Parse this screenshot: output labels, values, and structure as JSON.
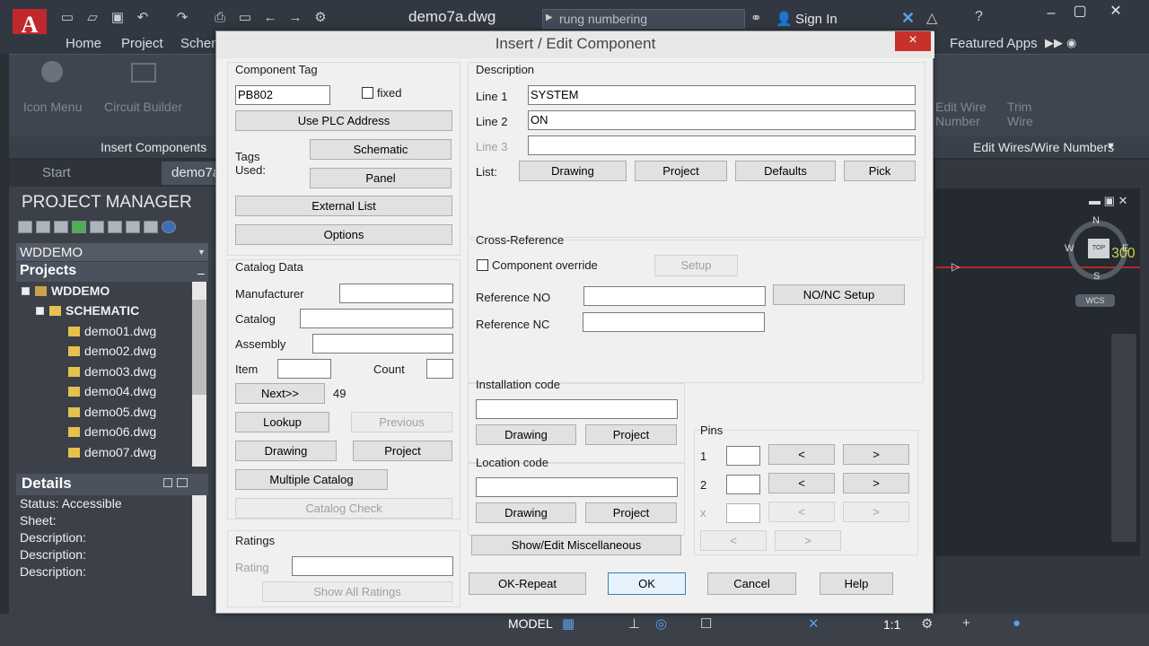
{
  "app": {
    "logo": "A",
    "doc_title": "demo7a.dwg",
    "search_placeholder": "rung numbering",
    "sign_in": "Sign In",
    "ribbon_tabs": [
      "Home",
      "Project",
      "Schem"
    ],
    "featured_apps": "Featured Apps",
    "ribbon_items": [
      "Icon Menu",
      "Circuit Builder",
      "Edit Wire Number",
      "Trim Wire"
    ],
    "ribbon_groups": [
      "Insert Components",
      "Edit Wires/Wire Numbers"
    ],
    "doc_tabs": [
      "Start",
      "demo7a"
    ]
  },
  "project_manager": {
    "title": "PROJECT MANAGER",
    "project_select": "WDDEMO",
    "projects_header": "Projects",
    "tree": {
      "root": "WDDEMO",
      "folder": "SCHEMATIC",
      "files": [
        "demo01.dwg",
        "demo02.dwg",
        "demo03.dwg",
        "demo04.dwg",
        "demo05.dwg",
        "demo06.dwg",
        "demo07.dwg"
      ]
    },
    "details_header": "Details",
    "details": [
      "Status: Accessible",
      "Sheet:",
      "Description:",
      "Description:",
      "Description:"
    ]
  },
  "canvas": {
    "compass": {
      "n": "N",
      "s": "S",
      "e": "E",
      "w": "W",
      "top": "TOP"
    },
    "wcs": "WCS",
    "value": "300"
  },
  "status": {
    "model": "MODEL",
    "scale": "1:1"
  },
  "dialog": {
    "title": "Insert / Edit Component",
    "close": "×",
    "component_tag": {
      "label": "Component Tag",
      "value": "PB802",
      "fixed_label": "fixed",
      "use_plc": "Use PLC Address",
      "tags_used": "Tags\nUsed:",
      "schematic": "Schematic",
      "panel": "Panel",
      "external_list": "External List",
      "options": "Options"
    },
    "catalog": {
      "label": "Catalog Data",
      "manufacturer": "Manufacturer",
      "catalog": "Catalog",
      "assembly": "Assembly",
      "item": "Item",
      "count": "Count",
      "next": "Next>>",
      "next_value": "49",
      "lookup": "Lookup",
      "previous": "Previous",
      "drawing": "Drawing",
      "project": "Project",
      "multiple": "Multiple Catalog",
      "check": "Catalog Check"
    },
    "ratings": {
      "label": "Ratings",
      "rating": "Rating",
      "show_all": "Show All Ratings"
    },
    "description": {
      "label": "Description",
      "line1_label": "Line 1",
      "line1": "SYSTEM",
      "line2_label": "Line 2",
      "line2": "ON",
      "line3_label": "Line 3",
      "line3": "",
      "list": "List:",
      "drawing": "Drawing",
      "project": "Project",
      "defaults": "Defaults",
      "pick": "Pick"
    },
    "xref": {
      "label": "Cross-Reference",
      "override": "Component override",
      "setup": "Setup",
      "ref_no": "Reference NO",
      "ref_nc": "Reference NC",
      "nonc_setup": "NO/NC Setup"
    },
    "installation": {
      "label": "Installation code",
      "drawing": "Drawing",
      "project": "Project"
    },
    "location": {
      "label": "Location code",
      "drawing": "Drawing",
      "project": "Project"
    },
    "pins": {
      "label": "Pins",
      "rows": [
        "1",
        "2",
        "x"
      ],
      "lt": "<",
      "gt": ">"
    },
    "show_edit_misc": "Show/Edit Miscellaneous",
    "ok_repeat": "OK-Repeat",
    "ok": "OK",
    "cancel": "Cancel",
    "help": "Help"
  }
}
